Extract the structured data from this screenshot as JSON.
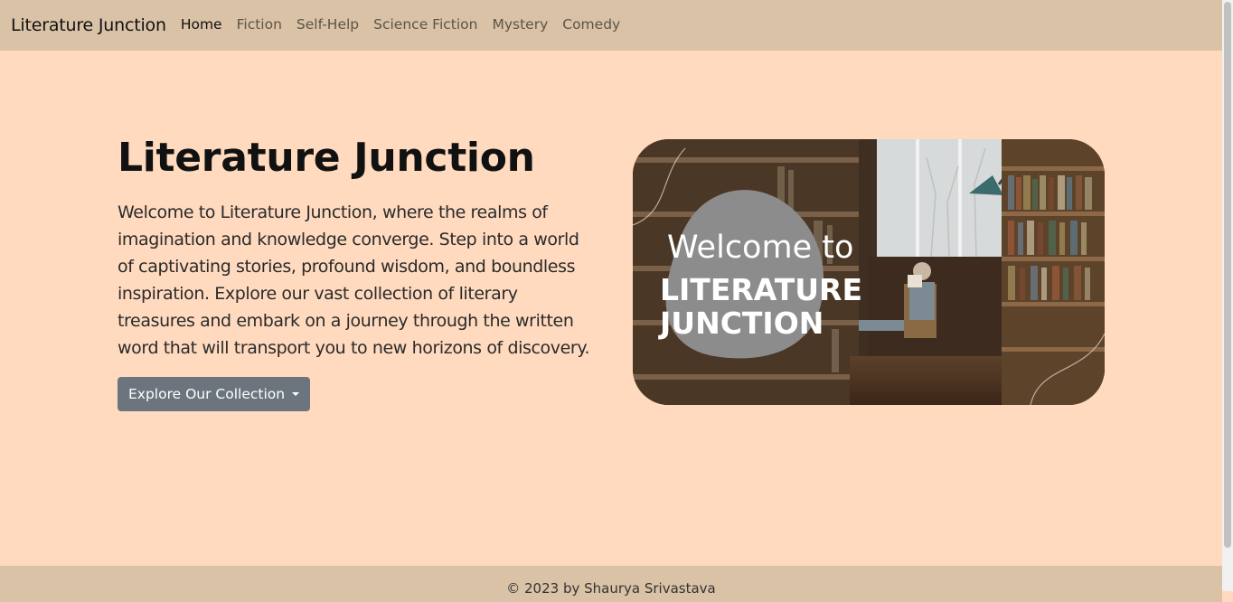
{
  "nav": {
    "brand": "Literature Junction",
    "links": [
      {
        "label": "Home",
        "active": true
      },
      {
        "label": "Fiction"
      },
      {
        "label": "Self-Help"
      },
      {
        "label": "Science Fiction"
      },
      {
        "label": "Mystery"
      },
      {
        "label": "Comedy"
      }
    ]
  },
  "hero": {
    "title": "Literature Junction",
    "description": "Welcome to Literature Junction, where the realms of imagination and knowledge converge. Step into a world of captivating stories, profound wisdom, and boundless inspiration. Explore our vast collection of literary treasures and embark on a journey through the written word that will transport you to new horizons of discovery.",
    "button_label": "Explore Our Collection",
    "image": {
      "line1": "Welcome to",
      "line2": "LITERATURE",
      "line3": "JUNCTION"
    }
  },
  "footer": {
    "text": "© 2023 by Shaurya Srivastava"
  },
  "colors": {
    "navbar": "#d9c2a6",
    "background": "#ffdabf",
    "button": "#6c757d"
  }
}
